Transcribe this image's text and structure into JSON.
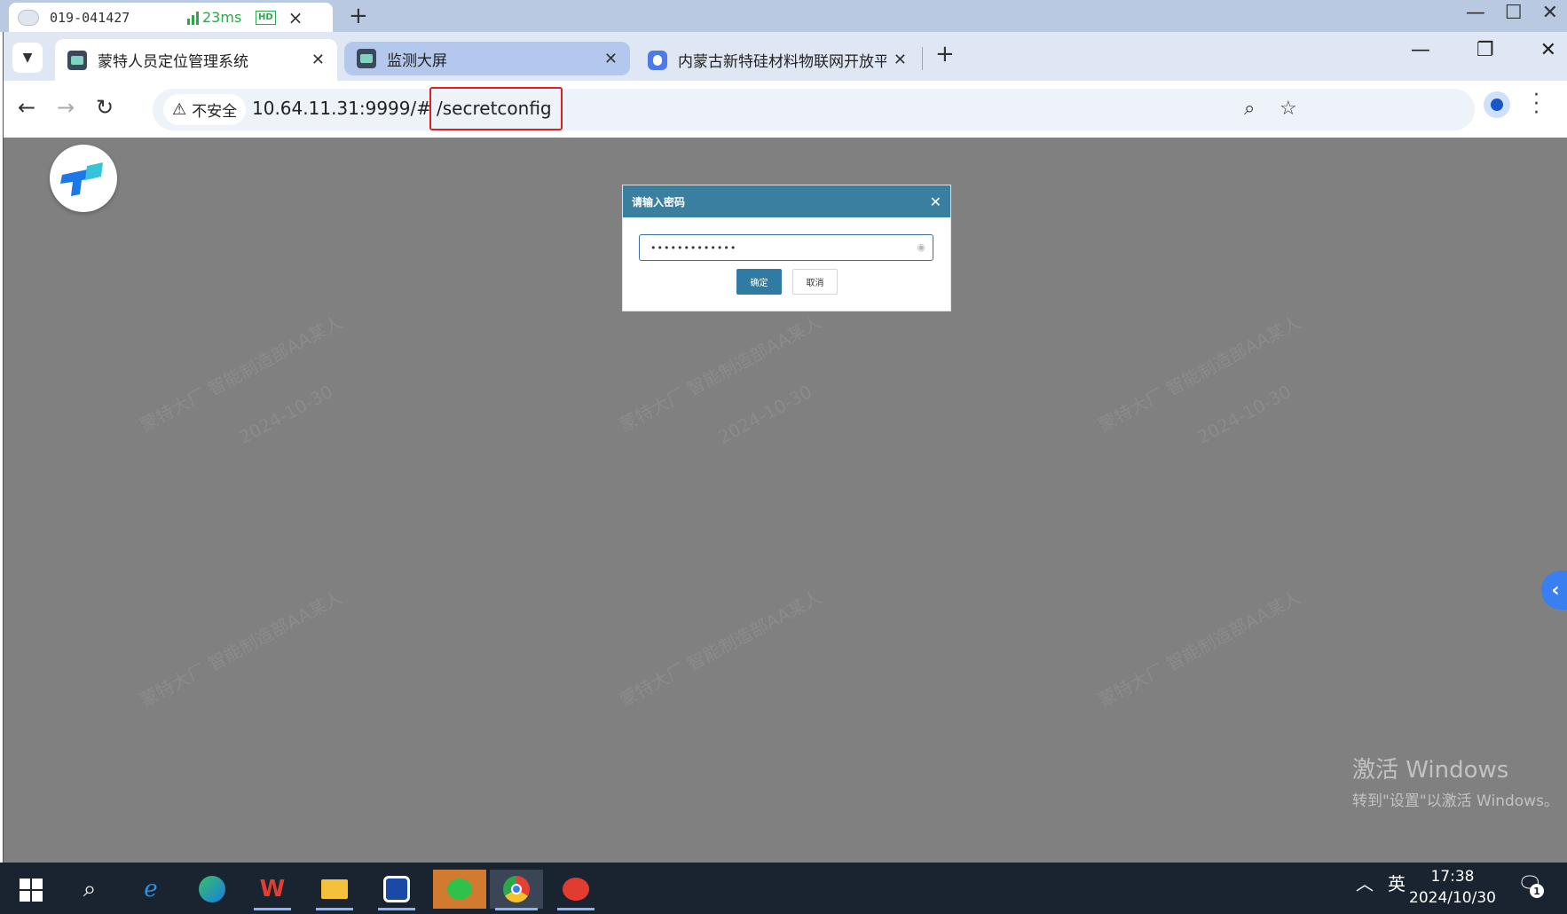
{
  "remote_session": {
    "id": "019-041427",
    "ping": "23ms",
    "quality_badge": "HD",
    "close_icon": "×",
    "add_icon": "+"
  },
  "browser": {
    "tabs": [
      {
        "title": "蒙特人员定位管理系统",
        "favicon": "app-icon",
        "state": "active"
      },
      {
        "title": "监测大屏",
        "favicon": "app-icon",
        "state": "highlighted"
      },
      {
        "title": "内蒙古新特硅材料物联网开放平",
        "favicon": "map-pin-icon",
        "state": "inactive"
      }
    ],
    "close_glyph": "✕",
    "security_label": "不安全",
    "url_host": "10.64.11.31:9999/#",
    "url_path": "/secretconfig",
    "accent_color": "#e02020"
  },
  "dialog": {
    "title": "请输入密码",
    "password_mask": "•••••••••••••",
    "confirm_label": "确定",
    "cancel_label": "取消",
    "header_color": "#3a7fa0"
  },
  "watermark": {
    "line1": "蒙特大厂 智能制造部AA某人",
    "line2": "2024-10-30"
  },
  "activation": {
    "title": "激活 Windows",
    "subtitle": "转到\"设置\"以激活 Windows。"
  },
  "taskbar": {
    "language": "英",
    "time": "17:38",
    "date": "2024/10/30",
    "notification_count": "1"
  }
}
